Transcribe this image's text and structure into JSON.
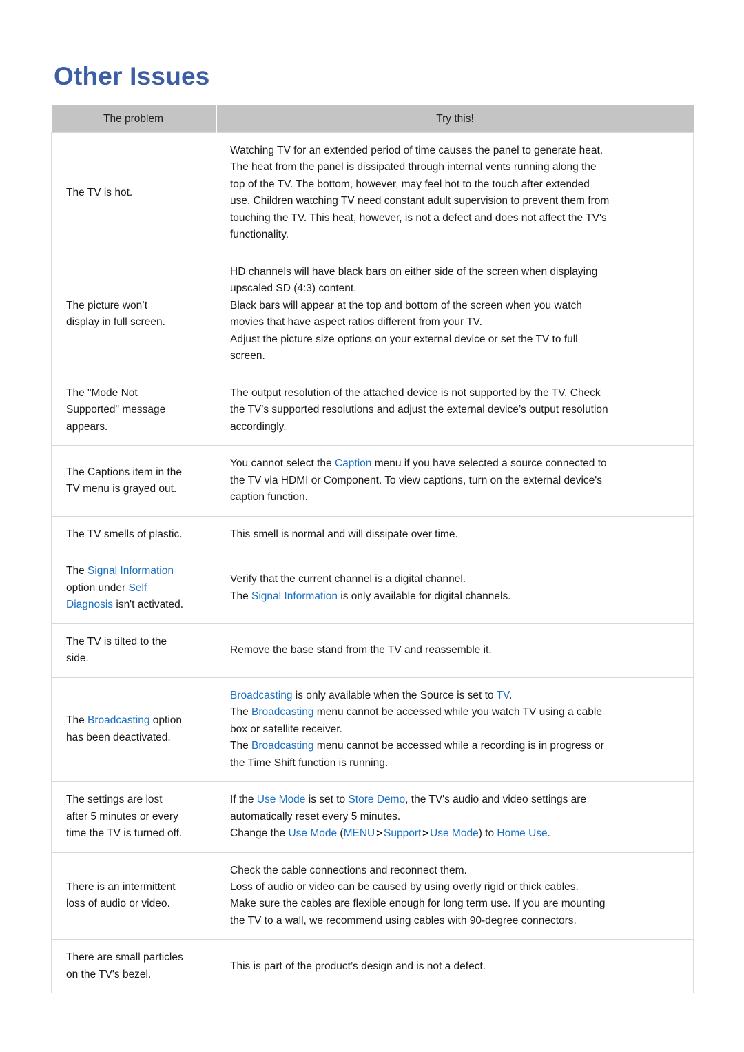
{
  "page": {
    "title": "Other Issues",
    "title_color": "#3c5ea6",
    "accent_color": "#1a6fc4",
    "header_bg": "#c4c4c4",
    "background": "#ffffff"
  },
  "table": {
    "headers": {
      "problem": "The problem",
      "solution": "Try this!"
    },
    "rows": [
      {
        "problem": [
          {
            "runs": [
              {
                "t": "The TV is hot."
              }
            ]
          }
        ],
        "solution": [
          {
            "runs": [
              {
                "t": "Watching TV for an extended period of time causes the panel to generate heat."
              }
            ]
          },
          {
            "runs": [
              {
                "t": "The heat from the panel is dissipated through internal vents running along the"
              }
            ]
          },
          {
            "runs": [
              {
                "t": "top of the TV. The bottom, however, may feel hot to the touch after extended"
              }
            ]
          },
          {
            "runs": [
              {
                "t": "use. Children watching TV need constant adult supervision to prevent them from"
              }
            ]
          },
          {
            "runs": [
              {
                "t": "touching the TV. This heat, however, is not a defect and does not affect the TV's"
              }
            ]
          },
          {
            "runs": [
              {
                "t": "functionality."
              }
            ]
          }
        ]
      },
      {
        "problem": [
          {
            "runs": [
              {
                "t": "The picture won’t"
              }
            ]
          },
          {
            "runs": [
              {
                "t": "display in full screen."
              }
            ]
          }
        ],
        "solution": [
          {
            "runs": [
              {
                "t": "HD channels will have black bars on either side of the screen when displaying"
              }
            ]
          },
          {
            "runs": [
              {
                "t": "upscaled SD (4:3) content."
              }
            ]
          },
          {
            "runs": [
              {
                "t": "Black bars will appear at the top and bottom of the screen when you watch"
              }
            ]
          },
          {
            "runs": [
              {
                "t": "movies that have aspect ratios different from your TV."
              }
            ]
          },
          {
            "runs": [
              {
                "t": "Adjust the picture size options on your external device or set the TV to full"
              }
            ]
          },
          {
            "runs": [
              {
                "t": "screen."
              }
            ]
          }
        ]
      },
      {
        "problem": [
          {
            "runs": [
              {
                "t": "The \"Mode Not"
              }
            ]
          },
          {
            "runs": [
              {
                "t": "Supported\" message"
              }
            ]
          },
          {
            "runs": [
              {
                "t": "appears."
              }
            ]
          }
        ],
        "solution": [
          {
            "runs": [
              {
                "t": "The output resolution of the attached device is not supported by the TV. Check"
              }
            ]
          },
          {
            "runs": [
              {
                "t": "the TV's supported resolutions and adjust the external device’s output resolution"
              }
            ]
          },
          {
            "runs": [
              {
                "t": "accordingly."
              }
            ]
          }
        ]
      },
      {
        "problem": [
          {
            "runs": [
              {
                "t": "The Captions item in the"
              }
            ]
          },
          {
            "runs": [
              {
                "t": "TV menu is grayed out."
              }
            ]
          }
        ],
        "solution": [
          {
            "runs": [
              {
                "t": "You cannot select the "
              },
              {
                "t": "Caption",
                "a": true
              },
              {
                "t": " menu if you have selected a source connected to"
              }
            ]
          },
          {
            "runs": [
              {
                "t": "the TV via HDMI or Component. To view captions, turn on the external device's"
              }
            ]
          },
          {
            "runs": [
              {
                "t": "caption function."
              }
            ]
          }
        ]
      },
      {
        "problem": [
          {
            "runs": [
              {
                "t": "The TV smells of plastic."
              }
            ]
          }
        ],
        "solution": [
          {
            "runs": [
              {
                "t": "This smell is normal and will dissipate over time."
              }
            ]
          }
        ]
      },
      {
        "problem": [
          {
            "runs": [
              {
                "t": "The "
              },
              {
                "t": "Signal Information",
                "a": true
              }
            ]
          },
          {
            "runs": [
              {
                "t": "option under "
              },
              {
                "t": "Self",
                "a": true
              }
            ]
          },
          {
            "runs": [
              {
                "t": "Diagnosis",
                "a": true
              },
              {
                "t": " isn't activated."
              }
            ]
          }
        ],
        "solution": [
          {
            "runs": [
              {
                "t": "Verify that the current channel is a digital channel."
              }
            ]
          },
          {
            "runs": [
              {
                "t": "The "
              },
              {
                "t": "Signal Information",
                "a": true
              },
              {
                "t": " is only available for digital channels."
              }
            ]
          }
        ]
      },
      {
        "problem": [
          {
            "runs": [
              {
                "t": "The TV is tilted to the"
              }
            ]
          },
          {
            "runs": [
              {
                "t": "side."
              }
            ]
          }
        ],
        "solution": [
          {
            "runs": [
              {
                "t": "Remove the base stand from the TV and reassemble it."
              }
            ]
          }
        ]
      },
      {
        "problem": [
          {
            "runs": [
              {
                "t": "The "
              },
              {
                "t": "Broadcasting",
                "a": true
              },
              {
                "t": " option"
              }
            ]
          },
          {
            "runs": [
              {
                "t": "has been deactivated."
              }
            ]
          }
        ],
        "solution": [
          {
            "runs": [
              {
                "t": "Broadcasting",
                "a": true
              },
              {
                "t": " is only available when the Source is set to "
              },
              {
                "t": "TV",
                "a": true
              },
              {
                "t": "."
              }
            ]
          },
          {
            "runs": [
              {
                "t": "The "
              },
              {
                "t": "Broadcasting",
                "a": true
              },
              {
                "t": " menu cannot be accessed while you watch TV using a cable"
              }
            ]
          },
          {
            "runs": [
              {
                "t": "box or satellite receiver."
              }
            ]
          },
          {
            "runs": [
              {
                "t": "The "
              },
              {
                "t": "Broadcasting",
                "a": true
              },
              {
                "t": " menu cannot be accessed while a recording is in progress or"
              }
            ]
          },
          {
            "runs": [
              {
                "t": "the Time Shift function is running."
              }
            ]
          }
        ]
      },
      {
        "problem": [
          {
            "runs": [
              {
                "t": "The settings are lost"
              }
            ]
          },
          {
            "runs": [
              {
                "t": "after 5 minutes or every"
              }
            ]
          },
          {
            "runs": [
              {
                "t": "time the TV is turned off."
              }
            ]
          }
        ],
        "solution": [
          {
            "runs": [
              {
                "t": "If the "
              },
              {
                "t": "Use Mode",
                "a": true
              },
              {
                "t": " is set to "
              },
              {
                "t": "Store Demo",
                "a": true
              },
              {
                "t": ", the TV's audio and video settings are"
              }
            ]
          },
          {
            "runs": [
              {
                "t": "automatically reset every 5 minutes."
              }
            ]
          },
          {
            "runs": [
              {
                "t": "Change the "
              },
              {
                "t": "Use Mode",
                "a": true
              },
              {
                "t": " ("
              },
              {
                "t": "MENU",
                "a": true
              },
              {
                "t": ">",
                "c": true
              },
              {
                "t": "Support",
                "a": true
              },
              {
                "t": ">",
                "c": true
              },
              {
                "t": "Use Mode",
                "a": true
              },
              {
                "t": ") to "
              },
              {
                "t": "Home Use",
                "a": true
              },
              {
                "t": "."
              }
            ]
          }
        ]
      },
      {
        "problem": [
          {
            "runs": [
              {
                "t": "There is an intermittent"
              }
            ]
          },
          {
            "runs": [
              {
                "t": "loss of audio or video."
              }
            ]
          }
        ],
        "solution": [
          {
            "runs": [
              {
                "t": "Check the cable connections and reconnect them."
              }
            ]
          },
          {
            "runs": [
              {
                "t": "Loss of audio or video can be caused by using overly rigid or thick cables."
              }
            ]
          },
          {
            "runs": [
              {
                "t": "Make sure the cables are flexible enough for long term use. If you are mounting"
              }
            ]
          },
          {
            "runs": [
              {
                "t": "the TV to a wall, we recommend using cables with 90-degree connectors."
              }
            ]
          }
        ]
      },
      {
        "problem": [
          {
            "runs": [
              {
                "t": "There are small particles"
              }
            ]
          },
          {
            "runs": [
              {
                "t": "on the TV's bezel."
              }
            ]
          }
        ],
        "solution": [
          {
            "runs": [
              {
                "t": "This is part of the product’s design and is not a defect."
              }
            ]
          }
        ]
      }
    ]
  }
}
